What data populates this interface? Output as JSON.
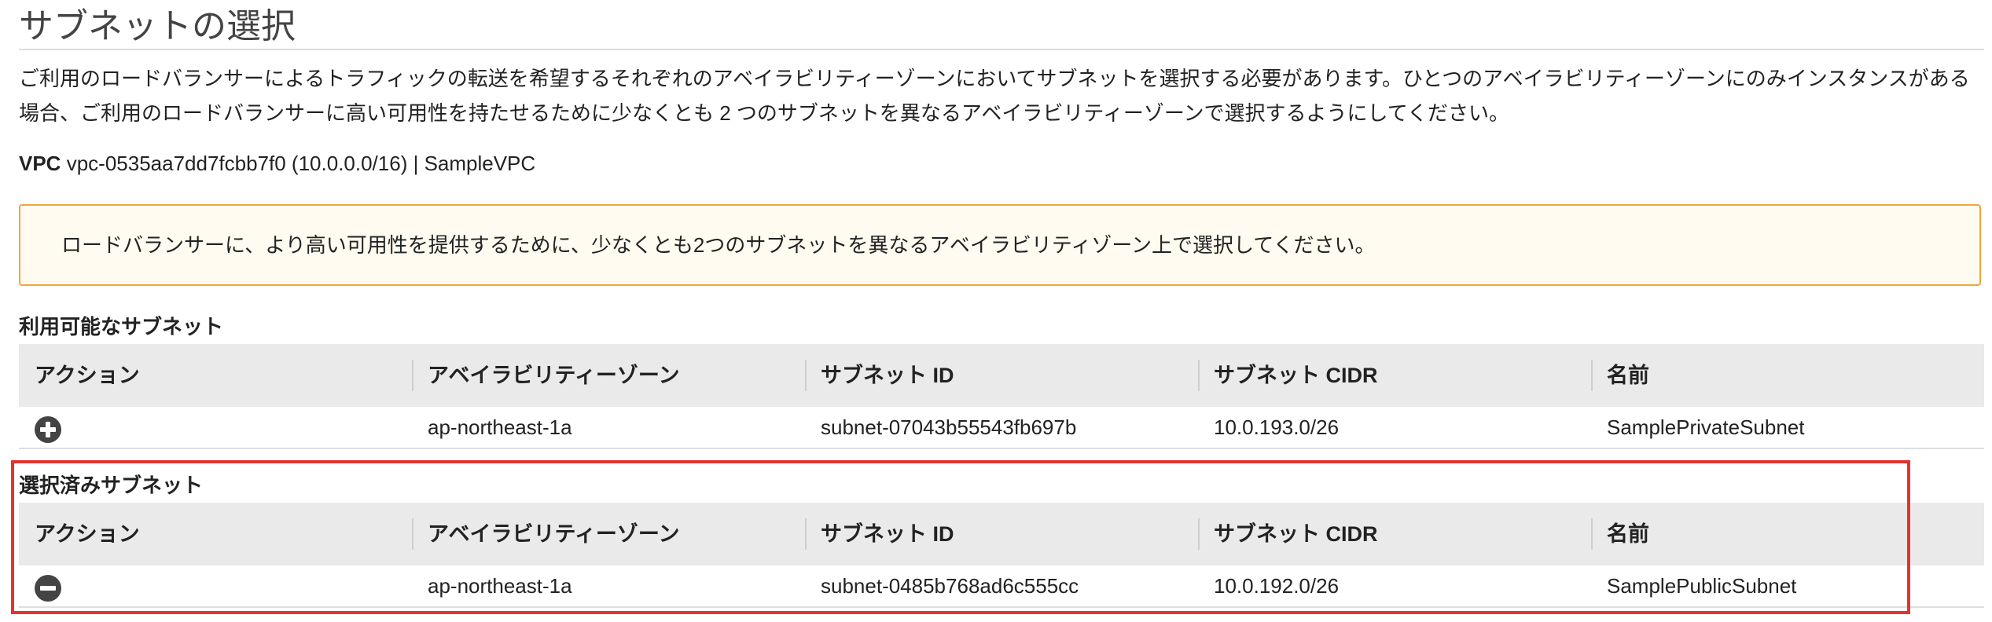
{
  "header": {
    "title": "サブネットの選択",
    "description": "ご利用のロードバランサーによるトラフィックの転送を希望するそれぞれのアベイラビリティーゾーンにおいてサブネットを選択する必要があります。ひとつのアベイラビリティーゾーンにのみインスタンスがある場合、ご利用のロードバランサーに高い可用性を持たせるために少なくとも 2 つのサブネットを異なるアベイラビリティーゾーンで選択するようにしてください。"
  },
  "vpc": {
    "label": "VPC",
    "value": "vpc-0535aa7dd7fcbb7f0 (10.0.0.0/16) | SampleVPC"
  },
  "warning": {
    "text": "ロードバランサーに、より高い可用性を提供するために、少なくとも2つのサブネットを異なるアベイラビリティゾーン上で選択してください。"
  },
  "columns": [
    "アクション",
    "アベイラビリティーゾーン",
    "サブネット ID",
    "サブネット CIDR",
    "名前"
  ],
  "available": {
    "title": "利用可能なサブネット",
    "rows": [
      {
        "action_icon": "plus-circle-icon",
        "az": "ap-northeast-1a",
        "subnet_id": "subnet-07043b55543fb697b",
        "cidr": "10.0.193.0/26",
        "name": "SamplePrivateSubnet"
      }
    ]
  },
  "selected": {
    "title": "選択済みサブネット",
    "rows": [
      {
        "action_icon": "minus-circle-icon",
        "az": "ap-northeast-1a",
        "subnet_id": "subnet-0485b768ad6c555cc",
        "cidr": "10.0.192.0/26",
        "name": "SamplePublicSubnet"
      }
    ]
  },
  "colors": {
    "highlight": "#e6322d",
    "warning_border": "#f0a63a",
    "warning_background": "#fffbf0",
    "header_background": "#eaeaea"
  }
}
